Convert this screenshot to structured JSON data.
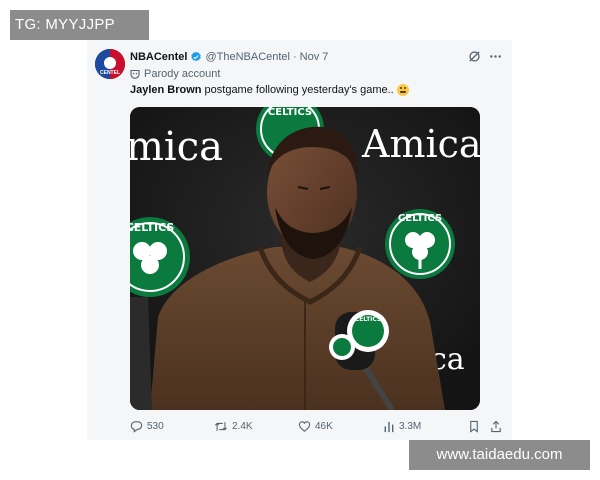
{
  "watermarks": {
    "top_left": "TG: MYYJJPP",
    "bottom_right": "www.taidaedu.com"
  },
  "tweet": {
    "avatar_icon": "nba-centel-logo",
    "avatar_text": "CENTEL",
    "display_name": "NBACentel",
    "verified_icon": "verified-badge-icon",
    "handle": "@TheNBACentel",
    "separator": "·",
    "date": "Nov 7",
    "parody_label": "Parody account",
    "text_bold": "Jaylen Brown",
    "text_rest": "postgame following yesterday's game..",
    "emoji": "grimacing-face",
    "media_alt": "Jaylen Brown at press conference with Amica and Celtics logos on backdrop",
    "backdrop_text_left": "mica",
    "backdrop_text_right": "Amica",
    "backdrop_text_bottom": "ca",
    "logo_text": "CELTICS",
    "mic_logo_text": "CELTICS"
  },
  "actions": {
    "replies": "530",
    "reposts": "2.4K",
    "likes": "46K",
    "views": "3.3M"
  },
  "colors": {
    "celtics_green": "#0b7a3e",
    "jacket_brown": "#5a3c26",
    "backdrop": "#1c1c1c",
    "muted_text": "#536471",
    "verified_blue": "#1d9bf0"
  }
}
